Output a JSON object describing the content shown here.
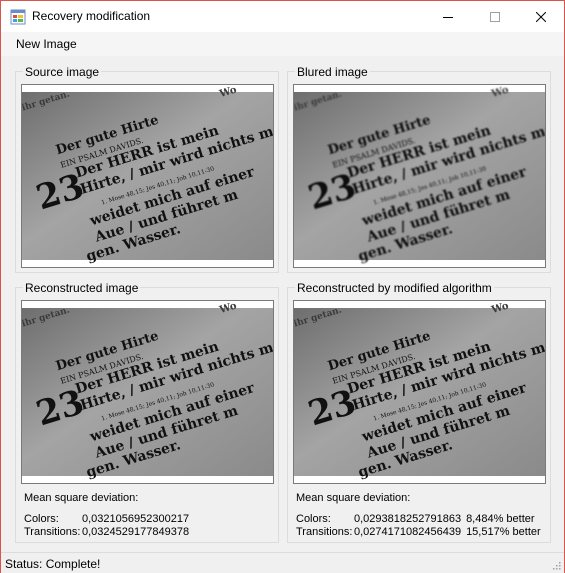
{
  "window": {
    "title": "Recovery modification",
    "icon": "app-window-icon",
    "controls": [
      "minimize-icon",
      "maximize-icon",
      "close-icon"
    ]
  },
  "menu": {
    "items": [
      {
        "label": "New Image"
      }
    ]
  },
  "panels": {
    "source": {
      "title": "Source image"
    },
    "blured": {
      "title": "Blured image"
    },
    "reconstructed": {
      "title": "Reconstructed image"
    },
    "modified": {
      "title": "Reconstructed by modified algorithm"
    }
  },
  "image_text": {
    "heading": "Der gute Hirte",
    "big_number": "23",
    "line1": "EIN PSALM DAVIDS.",
    "line2": "Der HERR ist mein",
    "line3": "Hirte, / mir wird nichts man-",
    "line4": "weidet mich auf einer",
    "line5": "Aue / und führet m",
    "line6": "gen. Wasser.",
    "ref": "1. Mose 48,15; Jes 40,11; Joh 10,11-30",
    "top_left": "was ihr getan.",
    "top_right": "Wo"
  },
  "stats": {
    "reconstructed": {
      "heading": "Mean square deviation:",
      "colors_label": "Colors:",
      "colors_value": "0,0321056952300217",
      "transitions_label": "Transitions:",
      "transitions_value": "0,0324529177849378"
    },
    "modified": {
      "heading": "Mean square deviation:",
      "colors_label": "Colors:",
      "colors_value": "0,0293818252791863",
      "colors_better": "8,484% better",
      "transitions_label": "Transitions:",
      "transitions_value": "0,0274171082456439",
      "transitions_better": "15,517% better"
    }
  },
  "status": {
    "text": "Status: Complete!"
  },
  "colors": {
    "window_border": "#d9534f",
    "form_background": "#f0f0f0",
    "groupbox_border": "#dcdcdc",
    "image_background": "#8c8c8c"
  }
}
